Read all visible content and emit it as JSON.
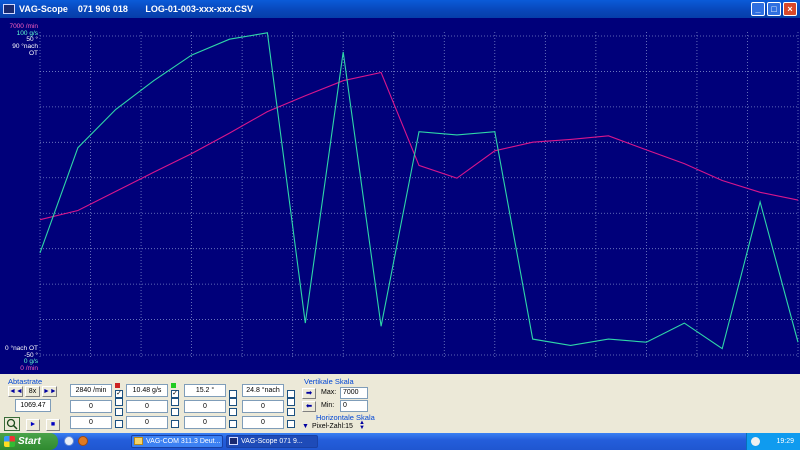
{
  "window": {
    "title": "VAG-Scope    071 906 018       LOG-01-003-xxx-xxx.CSV",
    "buttons": [
      "_",
      "□",
      "×"
    ]
  },
  "scope": {
    "colors": {
      "background": "#00007a",
      "grid": "#7a86c8",
      "rpm": "#d8168c",
      "airflow": "#2fd6a8"
    },
    "y_top_labels": [
      {
        "text": "7000 /min",
        "color": "#ff60c0"
      },
      {
        "text": "100 g/s",
        "color": "#60ffd0"
      },
      {
        "text": "50 °",
        "color": "#ffffff"
      },
      {
        "text": "90 °nach OT",
        "color": "#ffffff"
      }
    ],
    "y_bottom_labels": [
      {
        "text": "0 °nach OT",
        "color": "#ffffff"
      },
      {
        "text": "-50 °",
        "color": "#ffffff"
      },
      {
        "text": "0 g/s",
        "color": "#60ffd0"
      },
      {
        "text": "0 /min",
        "color": "#ff60c0"
      }
    ]
  },
  "chart_data": {
    "type": "line",
    "grid": true,
    "x": [
      0,
      5,
      10,
      15,
      20,
      25,
      30,
      35,
      40,
      45,
      50,
      55,
      60,
      65,
      70,
      75,
      80,
      85,
      90,
      95,
      100
    ],
    "series": [
      {
        "name": "2840 /min",
        "color": "#d8168c",
        "axis_max": 7000,
        "values": [
          2970,
          3170,
          3590,
          4010,
          4420,
          4870,
          5340,
          5690,
          6020,
          6200,
          4160,
          3880,
          4480,
          4670,
          4730,
          4810,
          4500,
          4200,
          3830,
          3570,
          3400
        ]
      },
      {
        "name": "10.48 g/s",
        "color": "#2fd6a8",
        "values": [
          32,
          65,
          77,
          86,
          94,
          99,
          101,
          10,
          95,
          9,
          70,
          69,
          70,
          5,
          3,
          5,
          4,
          10,
          2,
          48,
          4
        ]
      }
    ]
  },
  "controls": {
    "abtastrate_label": "Abtastrate",
    "rewind": "◄◄",
    "speed": "8x",
    "forward": "►►",
    "rate_value": "1069.47",
    "play": "►",
    "stop": "■",
    "channels": [
      {
        "value": "2840 /min",
        "color": "#cc2222",
        "checked": "✓",
        "sub": "0"
      },
      {
        "value": "10.48 g/s",
        "color": "#22cc22",
        "checked": "✓",
        "sub": "0"
      },
      {
        "value": "15.2 °",
        "color": "",
        "checked": "",
        "sub": "0"
      },
      {
        "value": "24.8 °nach",
        "color": "",
        "checked": "",
        "sub": "0"
      }
    ],
    "vertikale_label": "Vertikale Skala",
    "max_label": "Max:",
    "max_value": "7000",
    "min_label": "Min:",
    "min_value": "0",
    "horizontale_label": "Horizontale Skala",
    "pixel_label": "Pixel-Zahl:15"
  },
  "taskbar": {
    "start": "Start",
    "tasks": [
      "VAG-COM 311.3 Deut...",
      "VAG-Scope    071 9..."
    ],
    "clock": "19:29"
  }
}
